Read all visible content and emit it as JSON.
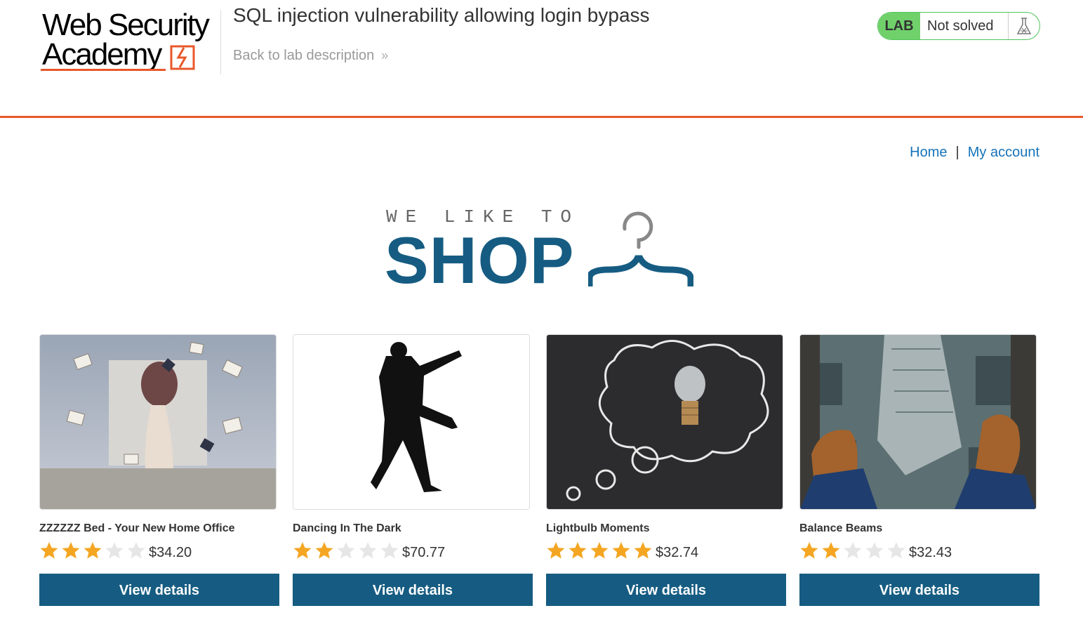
{
  "header": {
    "logo_line1": "Web Security",
    "logo_line2": "Academy",
    "lab_title": "SQL injection vulnerability allowing login bypass",
    "back_link": "Back to lab description",
    "back_chevron": "»",
    "status_badge": "LAB",
    "status_text": "Not solved",
    "status_icon": "flask-icon"
  },
  "nav": {
    "home": "Home",
    "separator": "|",
    "my_account": "My account"
  },
  "banner": {
    "top": "WE LIKE TO",
    "main": "SHOP",
    "icon": "hanger-icon"
  },
  "colors": {
    "accent_orange": "#e8582b",
    "primary_blue": "#165c82",
    "link_blue": "#1673b8",
    "star_gold": "#f4a623",
    "star_empty": "#e6e6e6",
    "lab_green": "#70d16b"
  },
  "products": [
    {
      "name": "ZZZZZZ Bed - Your New Home Office",
      "rating": 3,
      "price": "$34.20",
      "button": "View details",
      "image": "floating-books-photo"
    },
    {
      "name": "Dancing In The Dark",
      "rating": 2,
      "price": "$70.77",
      "button": "View details",
      "image": "dancer-silhouette"
    },
    {
      "name": "Lightbulb Moments",
      "rating": 5,
      "price": "$32.74",
      "button": "View details",
      "image": "lightbulb-chalk-cloud"
    },
    {
      "name": "Balance Beams",
      "rating": 2,
      "price": "$32.43",
      "button": "View details",
      "image": "feet-over-city"
    }
  ]
}
